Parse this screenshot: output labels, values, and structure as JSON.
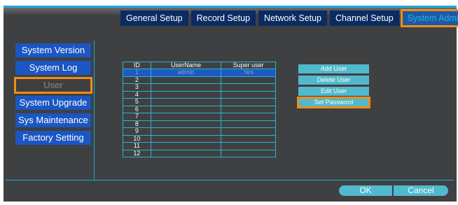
{
  "tabs": [
    {
      "label": "General Setup"
    },
    {
      "label": "Record Setup"
    },
    {
      "label": "Network Setup"
    },
    {
      "label": "Channel Setup"
    },
    {
      "label": "System Admin"
    }
  ],
  "sidebar": {
    "items": [
      {
        "label": "System Version"
      },
      {
        "label": "System Log"
      },
      {
        "label": "User"
      },
      {
        "label": "System Upgrade"
      },
      {
        "label": "Sys Maintenance"
      },
      {
        "label": "Factory Setting"
      }
    ]
  },
  "user_table": {
    "headers": [
      "ID",
      "UserName",
      "Super user"
    ],
    "rows": [
      {
        "id": "1",
        "username": "admin",
        "super": "Yes"
      },
      {
        "id": "2",
        "username": "",
        "super": ""
      },
      {
        "id": "3",
        "username": "",
        "super": ""
      },
      {
        "id": "4",
        "username": "",
        "super": ""
      },
      {
        "id": "5",
        "username": "",
        "super": ""
      },
      {
        "id": "6",
        "username": "",
        "super": ""
      },
      {
        "id": "7",
        "username": "",
        "super": ""
      },
      {
        "id": "8",
        "username": "",
        "super": ""
      },
      {
        "id": "9",
        "username": "",
        "super": ""
      },
      {
        "id": "10",
        "username": "",
        "super": ""
      },
      {
        "id": "11",
        "username": "",
        "super": ""
      },
      {
        "id": "12",
        "username": "",
        "super": ""
      }
    ]
  },
  "actions": {
    "add_user": "Add User",
    "delete_user": "Delete User",
    "edit_user": "Edit User",
    "set_password": "Set Password"
  },
  "footer": {
    "ok": "OK",
    "cancel": "Cancel"
  },
  "colors": {
    "panel_bg": "#3f4041",
    "accent_line": "#1aa9d3",
    "button_blue": "#1b56c3",
    "button_teal": "#52b8cc",
    "focus_outline": "#f28c18"
  }
}
